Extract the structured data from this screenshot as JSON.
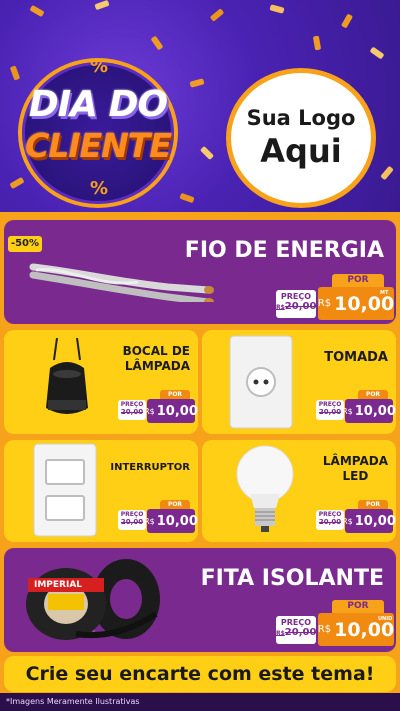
{
  "header": {
    "title_line1": "DIA DO",
    "title_line2": "CLIENTE",
    "percent_symbol": "%",
    "logo_line1": "Sua Logo",
    "logo_line2": "Aqui"
  },
  "products": {
    "fio": {
      "title": "FIO DE ENERGIA",
      "discount": "-50%",
      "por": "POR",
      "preco_label": "PREÇO",
      "old_prefix": "R$",
      "old_value": "20,00",
      "currency": "R$",
      "new_value": "10,00",
      "unit": "MT"
    },
    "bocal": {
      "title_line1": "BOCAL DE",
      "title_line2": "LÂMPADA",
      "por": "POR",
      "preco_label": "PREÇO",
      "old_value": "20,00",
      "currency": "R$",
      "new_value": "10,00",
      "unit": "UNID"
    },
    "tomada": {
      "title": "TOMADA",
      "por": "POR",
      "preco_label": "PREÇO",
      "old_value": "20,00",
      "currency": "R$",
      "new_value": "10,00",
      "unit": "UNID"
    },
    "interruptor": {
      "title": "INTERRUPTOR",
      "por": "POR",
      "preco_label": "PREÇO",
      "old_value": "20,00",
      "currency": "R$",
      "new_value": "10,00",
      "unit": "UNID"
    },
    "lampada": {
      "title_line1": "LÂMPADA",
      "title_line2": "LED",
      "por": "POR",
      "preco_label": "PREÇO",
      "old_value": "20,00",
      "currency": "R$",
      "new_value": "10,00",
      "unit": "UNID"
    },
    "fita": {
      "title": "FITA ISOLANTE",
      "por": "POR",
      "preco_label": "PREÇO",
      "old_prefix": "R$",
      "old_value": "20,00",
      "currency": "R$",
      "new_value": "10,00",
      "unit": "UNID",
      "brand": "IMPERIAL"
    }
  },
  "footer": {
    "cta": "Crie seu encarte com este tema!",
    "disclaimer": "*Imagens Meramente Ilustrativas"
  },
  "colors": {
    "purple_bg": "#4a22b3",
    "card_purple": "#7a2a8e",
    "card_yellow": "#ffcf16",
    "orange": "#f08a10"
  }
}
